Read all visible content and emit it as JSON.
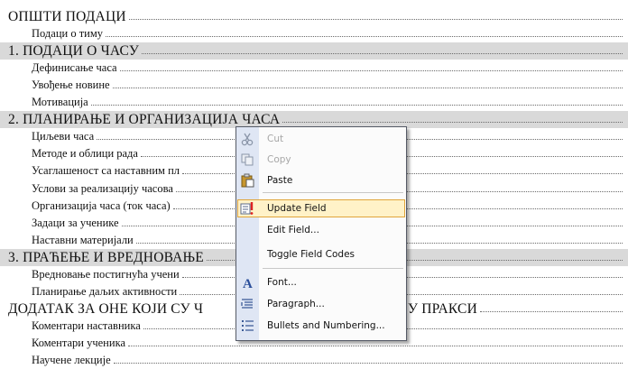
{
  "toc": [
    {
      "text": "ОПШТИ ПОДАЦИ",
      "level": 1,
      "shaded": false
    },
    {
      "text": "Подаци о тиму",
      "level": 2,
      "shaded": false
    },
    {
      "text": "1. ПОДАЦИ О ЧАСУ",
      "level": 1,
      "shaded": true
    },
    {
      "text": "Дефинисање часа",
      "level": 2,
      "shaded": false
    },
    {
      "text": "Увођење новине",
      "level": 2,
      "shaded": false
    },
    {
      "text": "Мотивација",
      "level": 2,
      "shaded": false
    },
    {
      "text": "2. ПЛАНИРАЊЕ И ОРГАНИЗАЦИЈА ЧАСА",
      "level": 1,
      "shaded": true
    },
    {
      "text": "Циљеви часа",
      "level": 2,
      "shaded": false
    },
    {
      "text": "Методе и облици рада",
      "level": 2,
      "shaded": false
    },
    {
      "text": "Усаглашеност са наставним пл",
      "level": 2,
      "shaded": false
    },
    {
      "text": "Услови за реализацију часова",
      "level": 2,
      "shaded": false
    },
    {
      "text": "Организација часа (ток часа)",
      "level": 2,
      "shaded": false
    },
    {
      "text": "Задаци за ученике",
      "level": 2,
      "shaded": false
    },
    {
      "text": "Наставни материјали",
      "level": 2,
      "shaded": false
    },
    {
      "text": "3. ПРАЋЕЊЕ И ВРЕДНОВАЊЕ",
      "level": 1,
      "shaded": true
    },
    {
      "text": "Вредновање постигнућа учени",
      "level": 2,
      "shaded": false
    },
    {
      "text": "Планирање даљих активности",
      "level": 2,
      "shaded": false
    },
    {
      "text": "ДОДАТАК ЗА ОНЕ КОЈИ СУ Ч",
      "level": 1,
      "shaded": false,
      "tail": "У ПРАКСИ"
    },
    {
      "text": "Коментари наставника",
      "level": 2,
      "shaded": false
    },
    {
      "text": "Коментари ученика",
      "level": 2,
      "shaded": false
    },
    {
      "text": "Научене лекције",
      "level": 2,
      "shaded": false
    }
  ],
  "context_menu": {
    "items": [
      {
        "label": "Cut",
        "icon": "scissors-icon",
        "disabled": true,
        "highlighted": false
      },
      {
        "label": "Copy",
        "icon": "copy-icon",
        "disabled": true,
        "highlighted": false
      },
      {
        "label": "Paste",
        "icon": "paste-icon",
        "disabled": false,
        "highlighted": false
      },
      {
        "label": "Update Field",
        "icon": "update-field-icon",
        "disabled": false,
        "highlighted": true
      },
      {
        "label": "Edit Field...",
        "icon": "",
        "disabled": false,
        "highlighted": false
      },
      {
        "label": "Toggle Field Codes",
        "icon": "",
        "disabled": false,
        "highlighted": false
      },
      {
        "label": "Font...",
        "icon": "font-icon",
        "disabled": false,
        "highlighted": false
      },
      {
        "label": "Paragraph...",
        "icon": "paragraph-icon",
        "disabled": false,
        "highlighted": false
      },
      {
        "label": "Bullets and Numbering...",
        "icon": "bullets-icon",
        "disabled": false,
        "highlighted": false
      }
    ]
  },
  "colors": {
    "field_shading": "#d9d9d9",
    "menu_highlight": "#fff2c8",
    "menu_highlight_border": "#e0a53a",
    "menu_gutter": "#dfe6f4"
  }
}
